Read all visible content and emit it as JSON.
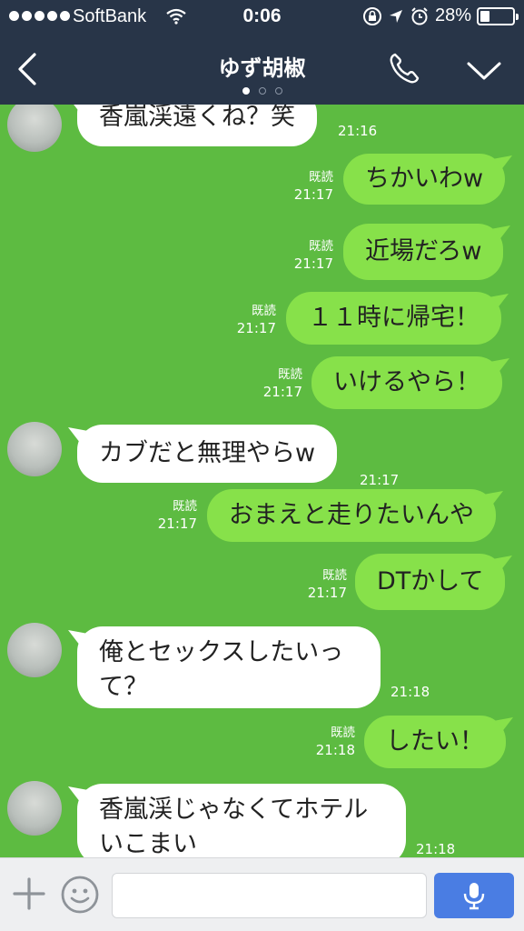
{
  "status_bar": {
    "carrier": "SoftBank",
    "time": "0:06",
    "battery_percent": "28%",
    "battery_level": 0.28
  },
  "header": {
    "title": "ゆず胡椒",
    "page_indicator": {
      "count": 3,
      "active": 0
    }
  },
  "messages": [
    {
      "side": "in",
      "text": "香嵐渓遠くね？笑",
      "time": "21:16"
    },
    {
      "side": "out",
      "text": "ちかいわw",
      "read": "既読",
      "time": "21:17"
    },
    {
      "side": "out",
      "text": "近場だろw",
      "read": "既読",
      "time": "21:17"
    },
    {
      "side": "out",
      "text": "１１時に帰宅！",
      "read": "既読",
      "time": "21:17"
    },
    {
      "side": "out",
      "text": "いけるやら！",
      "read": "既読",
      "time": "21:17"
    },
    {
      "side": "in",
      "text": "カブだと無理やらw",
      "time": "21:17"
    },
    {
      "side": "out",
      "text": "おまえと走りたいんや",
      "read": "既読",
      "time": "21:17"
    },
    {
      "side": "out",
      "text": "DTかして",
      "read": "既読",
      "time": "21:17"
    },
    {
      "side": "in",
      "text": "俺とセックスしたいって？",
      "lines": [
        "俺とセックスしたいっ",
        "て？"
      ],
      "time": "21:18"
    },
    {
      "side": "out",
      "text": "したい！",
      "read": "既読",
      "time": "21:18"
    },
    {
      "side": "in",
      "text": "香嵐渓じゃなくてホテルいこまい",
      "lines": [
        "香嵐渓じゃなくてホテル",
        "いこまい"
      ],
      "time": "21:18"
    }
  ],
  "input": {
    "placeholder": "",
    "value": ""
  },
  "colors": {
    "header_bg": "#283548",
    "chat_bg": "#5dbb41",
    "outgoing_bubble": "#87e14a",
    "incoming_bubble": "#ffffff",
    "mic_button": "#4a7de3"
  },
  "icons": [
    "back-icon",
    "phone-icon",
    "chevron-down-icon",
    "plus-icon",
    "emoji-icon",
    "microphone-icon",
    "wifi-icon",
    "lock-rotation-icon",
    "location-icon",
    "alarm-icon",
    "battery-icon"
  ]
}
